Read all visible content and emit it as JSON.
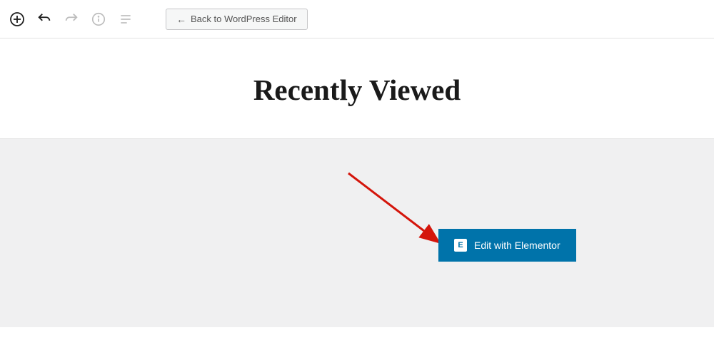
{
  "toolbar": {
    "back_button_label": "Back to WordPress Editor",
    "back_arrow": "←"
  },
  "page": {
    "title": "Recently Viewed"
  },
  "elementor": {
    "button_label": "Edit with Elementor",
    "icon_text": "E"
  }
}
